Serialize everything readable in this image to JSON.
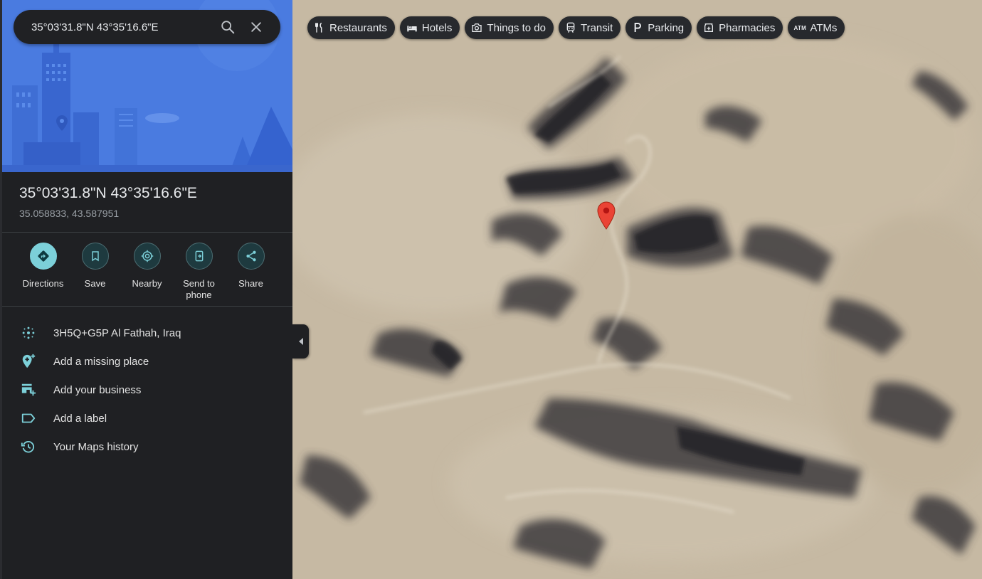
{
  "search": {
    "query": "35°03'31.8\"N 43°35'16.6\"E"
  },
  "place": {
    "title": "35°03'31.8\"N 43°35'16.6\"E",
    "decimal_coordinates": "35.058833, 43.587951"
  },
  "actions": [
    {
      "label": "Directions",
      "icon": "directions-icon"
    },
    {
      "label": "Save",
      "icon": "bookmark-icon"
    },
    {
      "label": "Nearby",
      "icon": "nearby-icon"
    },
    {
      "label": "Send to phone",
      "icon": "send-to-phone-icon"
    },
    {
      "label": "Share",
      "icon": "share-icon"
    }
  ],
  "list_items": [
    {
      "label": "3H5Q+G5P Al Fathah, Iraq",
      "icon": "plus-code-icon"
    },
    {
      "label": "Add a missing place",
      "icon": "add-place-icon"
    },
    {
      "label": "Add your business",
      "icon": "add-business-icon"
    },
    {
      "label": "Add a label",
      "icon": "label-icon"
    },
    {
      "label": "Your Maps history",
      "icon": "history-icon"
    }
  ],
  "chips": [
    {
      "label": "Restaurants",
      "icon": "restaurant-icon"
    },
    {
      "label": "Hotels",
      "icon": "hotel-icon"
    },
    {
      "label": "Things to do",
      "icon": "camera-icon"
    },
    {
      "label": "Transit",
      "icon": "transit-icon"
    },
    {
      "label": "Parking",
      "icon": "parking-icon"
    },
    {
      "label": "Pharmacies",
      "icon": "pharmacy-icon"
    },
    {
      "label": "ATMs",
      "icon": "atm-icon",
      "glyph": "ATM"
    }
  ],
  "colors": {
    "accent": "#7cd0d9",
    "hero_sky": "#4a7be0",
    "panel_bg": "#1f2023",
    "pin": "#ea4335"
  }
}
